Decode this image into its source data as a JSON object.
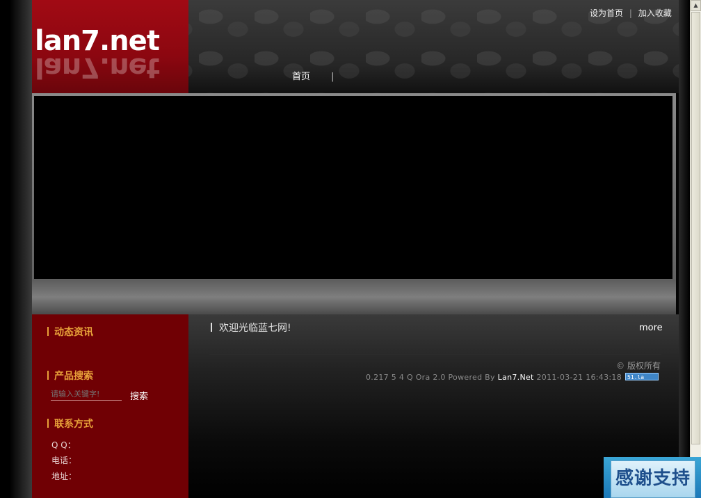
{
  "site": {
    "logo_text": "lan7.net",
    "top_links": {
      "set_home": "设为首页",
      "separator": "|",
      "bookmark": "加入收藏"
    },
    "nav": {
      "home": "首页",
      "separator": "|"
    }
  },
  "sidebar": {
    "news_title": "动态资讯",
    "search_title": "产品搜索",
    "search_placeholder": "请输入关键字!",
    "search_button": "搜索",
    "contact_title": "联系方式",
    "contact_qq": "Q Q：",
    "contact_phone": "电话：",
    "contact_address": "地址："
  },
  "main": {
    "welcome": "欢迎光临蓝七网!",
    "more": "more",
    "copyright": "© 版权所有",
    "powered_prefix": "0.217 5 4 Q Ora 2.0 Powered By",
    "powered_brand": "Lan7.Net",
    "powered_time": "2011-03-21 16:43:18",
    "stat_badge": "51.la"
  },
  "floating": {
    "label": "感谢支持"
  },
  "colors": {
    "logo_red": "#8c0710",
    "sidebar_red": "#700004",
    "section_title": "#e8a23a",
    "stat_badge": "#3f86c8"
  },
  "icons": {
    "scroll_up": "arrow-up-icon"
  }
}
